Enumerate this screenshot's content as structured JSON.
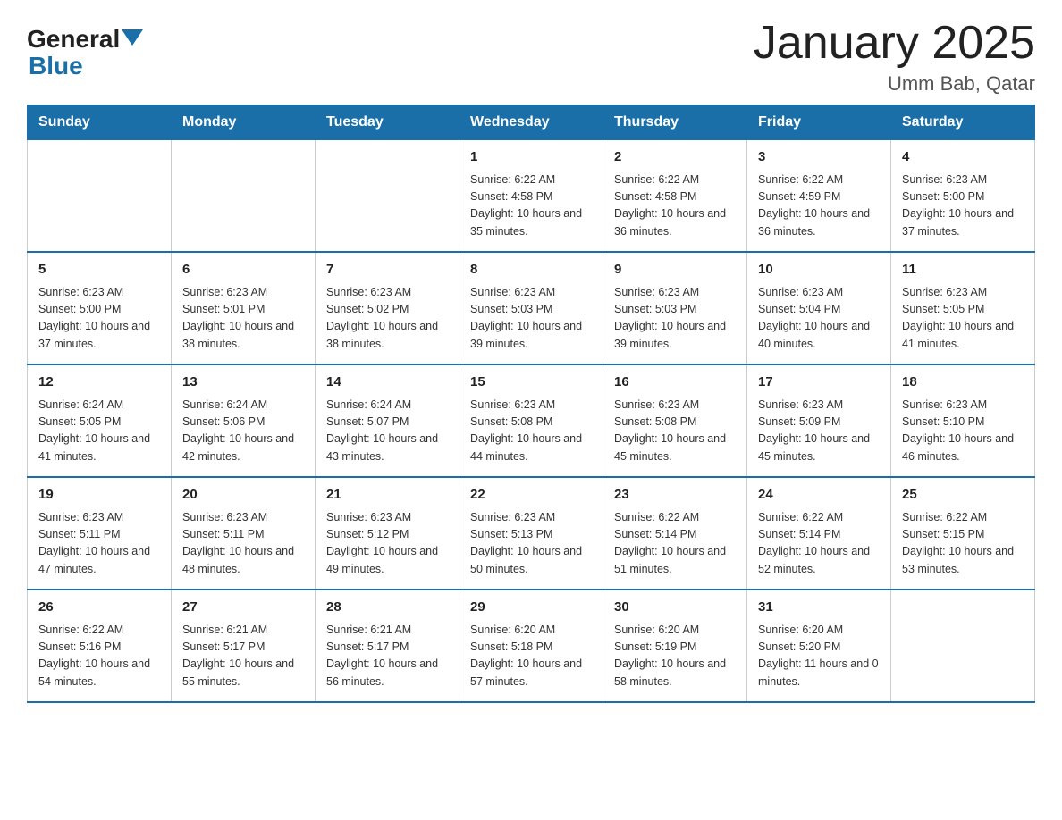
{
  "logo": {
    "general": "General",
    "blue": "Blue"
  },
  "title": "January 2025",
  "subtitle": "Umm Bab, Qatar",
  "days_of_week": [
    "Sunday",
    "Monday",
    "Tuesday",
    "Wednesday",
    "Thursday",
    "Friday",
    "Saturday"
  ],
  "weeks": [
    [
      {
        "day": "",
        "info": ""
      },
      {
        "day": "",
        "info": ""
      },
      {
        "day": "",
        "info": ""
      },
      {
        "day": "1",
        "info": "Sunrise: 6:22 AM\nSunset: 4:58 PM\nDaylight: 10 hours\nand 35 minutes."
      },
      {
        "day": "2",
        "info": "Sunrise: 6:22 AM\nSunset: 4:58 PM\nDaylight: 10 hours\nand 36 minutes."
      },
      {
        "day": "3",
        "info": "Sunrise: 6:22 AM\nSunset: 4:59 PM\nDaylight: 10 hours\nand 36 minutes."
      },
      {
        "day": "4",
        "info": "Sunrise: 6:23 AM\nSunset: 5:00 PM\nDaylight: 10 hours\nand 37 minutes."
      }
    ],
    [
      {
        "day": "5",
        "info": "Sunrise: 6:23 AM\nSunset: 5:00 PM\nDaylight: 10 hours\nand 37 minutes."
      },
      {
        "day": "6",
        "info": "Sunrise: 6:23 AM\nSunset: 5:01 PM\nDaylight: 10 hours\nand 38 minutes."
      },
      {
        "day": "7",
        "info": "Sunrise: 6:23 AM\nSunset: 5:02 PM\nDaylight: 10 hours\nand 38 minutes."
      },
      {
        "day": "8",
        "info": "Sunrise: 6:23 AM\nSunset: 5:03 PM\nDaylight: 10 hours\nand 39 minutes."
      },
      {
        "day": "9",
        "info": "Sunrise: 6:23 AM\nSunset: 5:03 PM\nDaylight: 10 hours\nand 39 minutes."
      },
      {
        "day": "10",
        "info": "Sunrise: 6:23 AM\nSunset: 5:04 PM\nDaylight: 10 hours\nand 40 minutes."
      },
      {
        "day": "11",
        "info": "Sunrise: 6:23 AM\nSunset: 5:05 PM\nDaylight: 10 hours\nand 41 minutes."
      }
    ],
    [
      {
        "day": "12",
        "info": "Sunrise: 6:24 AM\nSunset: 5:05 PM\nDaylight: 10 hours\nand 41 minutes."
      },
      {
        "day": "13",
        "info": "Sunrise: 6:24 AM\nSunset: 5:06 PM\nDaylight: 10 hours\nand 42 minutes."
      },
      {
        "day": "14",
        "info": "Sunrise: 6:24 AM\nSunset: 5:07 PM\nDaylight: 10 hours\nand 43 minutes."
      },
      {
        "day": "15",
        "info": "Sunrise: 6:23 AM\nSunset: 5:08 PM\nDaylight: 10 hours\nand 44 minutes."
      },
      {
        "day": "16",
        "info": "Sunrise: 6:23 AM\nSunset: 5:08 PM\nDaylight: 10 hours\nand 45 minutes."
      },
      {
        "day": "17",
        "info": "Sunrise: 6:23 AM\nSunset: 5:09 PM\nDaylight: 10 hours\nand 45 minutes."
      },
      {
        "day": "18",
        "info": "Sunrise: 6:23 AM\nSunset: 5:10 PM\nDaylight: 10 hours\nand 46 minutes."
      }
    ],
    [
      {
        "day": "19",
        "info": "Sunrise: 6:23 AM\nSunset: 5:11 PM\nDaylight: 10 hours\nand 47 minutes."
      },
      {
        "day": "20",
        "info": "Sunrise: 6:23 AM\nSunset: 5:11 PM\nDaylight: 10 hours\nand 48 minutes."
      },
      {
        "day": "21",
        "info": "Sunrise: 6:23 AM\nSunset: 5:12 PM\nDaylight: 10 hours\nand 49 minutes."
      },
      {
        "day": "22",
        "info": "Sunrise: 6:23 AM\nSunset: 5:13 PM\nDaylight: 10 hours\nand 50 minutes."
      },
      {
        "day": "23",
        "info": "Sunrise: 6:22 AM\nSunset: 5:14 PM\nDaylight: 10 hours\nand 51 minutes."
      },
      {
        "day": "24",
        "info": "Sunrise: 6:22 AM\nSunset: 5:14 PM\nDaylight: 10 hours\nand 52 minutes."
      },
      {
        "day": "25",
        "info": "Sunrise: 6:22 AM\nSunset: 5:15 PM\nDaylight: 10 hours\nand 53 minutes."
      }
    ],
    [
      {
        "day": "26",
        "info": "Sunrise: 6:22 AM\nSunset: 5:16 PM\nDaylight: 10 hours\nand 54 minutes."
      },
      {
        "day": "27",
        "info": "Sunrise: 6:21 AM\nSunset: 5:17 PM\nDaylight: 10 hours\nand 55 minutes."
      },
      {
        "day": "28",
        "info": "Sunrise: 6:21 AM\nSunset: 5:17 PM\nDaylight: 10 hours\nand 56 minutes."
      },
      {
        "day": "29",
        "info": "Sunrise: 6:20 AM\nSunset: 5:18 PM\nDaylight: 10 hours\nand 57 minutes."
      },
      {
        "day": "30",
        "info": "Sunrise: 6:20 AM\nSunset: 5:19 PM\nDaylight: 10 hours\nand 58 minutes."
      },
      {
        "day": "31",
        "info": "Sunrise: 6:20 AM\nSunset: 5:20 PM\nDaylight: 11 hours\nand 0 minutes."
      },
      {
        "day": "",
        "info": ""
      }
    ]
  ]
}
